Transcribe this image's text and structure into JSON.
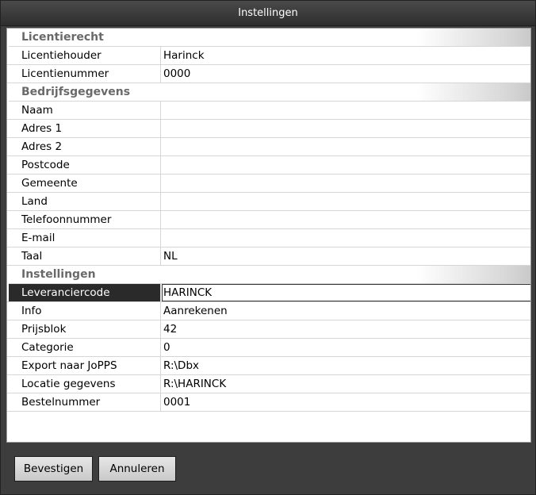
{
  "window": {
    "title": "Instellingen"
  },
  "sections": [
    {
      "title": "Licentierecht",
      "rows": [
        {
          "name": "Licentiehouder",
          "value": "Harinck"
        },
        {
          "name": "Licentienummer",
          "value": "0000"
        }
      ]
    },
    {
      "title": "Bedrijfsgegevens",
      "rows": [
        {
          "name": "Naam",
          "value": ""
        },
        {
          "name": "Adres 1",
          "value": ""
        },
        {
          "name": "Adres 2",
          "value": ""
        },
        {
          "name": "Postcode",
          "value": ""
        },
        {
          "name": "Gemeente",
          "value": ""
        },
        {
          "name": "Land",
          "value": ""
        },
        {
          "name": "Telefoonnummer",
          "value": ""
        },
        {
          "name": "E-mail",
          "value": ""
        },
        {
          "name": "Taal",
          "value": "NL"
        }
      ]
    },
    {
      "title": "Instellingen",
      "rows": [
        {
          "name": "Leveranciercode",
          "value": "HARINCK",
          "selected": true
        },
        {
          "name": "Info",
          "value": "Aanrekenen"
        },
        {
          "name": "Prijsblok",
          "value": "42"
        },
        {
          "name": "Categorie",
          "value": "0"
        },
        {
          "name": "Export naar JoPPS",
          "value": "R:\\Dbx"
        },
        {
          "name": "Locatie gegevens",
          "value": "R:\\HARINCK"
        },
        {
          "name": "Bestelnummer",
          "value": "0001"
        }
      ]
    }
  ],
  "buttons": {
    "confirm": "Bevestigen",
    "cancel": "Annuleren"
  }
}
